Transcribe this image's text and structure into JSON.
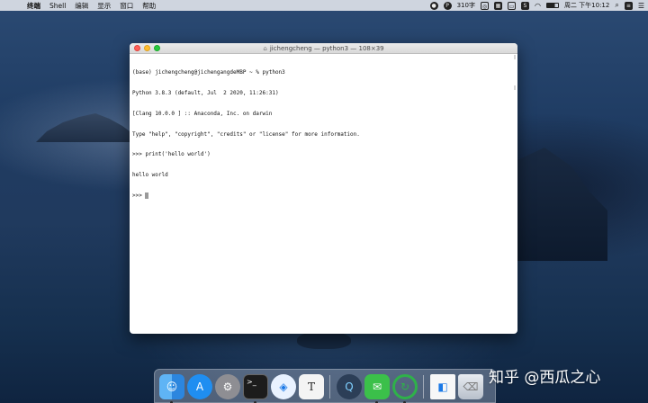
{
  "menubar": {
    "app_name": "终端",
    "items": [
      "Shell",
      "编辑",
      "显示",
      "窗口",
      "帮助"
    ],
    "status_text": "310字",
    "datetime": "周二 下午10:12"
  },
  "terminal": {
    "title": "jichengcheng — python3 — 108×39",
    "lines": [
      "(base) jichengcheng@jichengangdeMBP ~ % python3",
      "Python 3.8.3 (default, Jul  2 2020, 11:26:31)",
      "[Clang 10.0.0 ] :: Anaconda, Inc. on darwin",
      "Type \"help\", \"copyright\", \"credits\" or \"license\" for more information.",
      ">>> print('hello world')",
      "hello world"
    ],
    "prompt": ">>> "
  },
  "dock": {
    "icons": [
      "finder-icon",
      "app-store-icon",
      "system-preferences-icon",
      "terminal-icon",
      "safari-icon",
      "typora-icon",
      "quicktime-icon",
      "wechat-icon",
      "refresh-app-icon",
      "document-icon",
      "trash-icon"
    ]
  },
  "watermark": "知乎 @西瓜之心"
}
